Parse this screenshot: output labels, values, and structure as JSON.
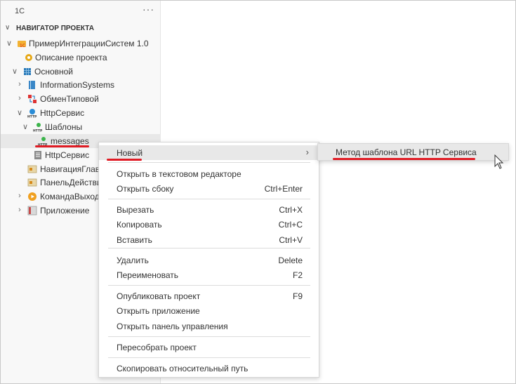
{
  "sidebar": {
    "title": "1С",
    "more_label": "···",
    "section": {
      "chevron": "∨",
      "label": "НАВИГАТОР ПРОЕКТА"
    },
    "tree": [
      {
        "name": "tree-item-project",
        "twisty": "∨",
        "icon": "project-1c-icon",
        "label": "ПримерИнтеграцииСистем 1.0"
      },
      {
        "name": "tree-item-project-description",
        "twisty": "",
        "icon": "gear-icon",
        "label": "Описание проекта"
      },
      {
        "name": "tree-item-main",
        "twisty": "∨",
        "icon": "grid-icon",
        "label": "Основной"
      },
      {
        "name": "tree-item-information-systems",
        "twisty": "›",
        "icon": "book-icon",
        "label": "InformationSystems"
      },
      {
        "name": "tree-item-exchange",
        "twisty": "›",
        "icon": "exchange-icon",
        "label": "ОбменТиповой"
      },
      {
        "name": "tree-item-http-service",
        "twisty": "∨",
        "icon": "http-globe-icon",
        "label": "HttpСервис"
      },
      {
        "name": "tree-item-templates",
        "twisty": "∨",
        "icon": "http-icon",
        "label": "Шаблоны"
      },
      {
        "name": "tree-item-messages",
        "twisty": "",
        "icon": "http-icon",
        "label": "messages"
      },
      {
        "name": "tree-item-http-service-module",
        "twisty": "",
        "icon": "module-icon",
        "label": "HttpСервис"
      },
      {
        "name": "tree-item-navigation",
        "twisty": "",
        "icon": "panel-icon",
        "label": "НавигацияГлав"
      },
      {
        "name": "tree-item-action-panel",
        "twisty": "",
        "icon": "panel-icon",
        "label": "ПанельДействи"
      },
      {
        "name": "tree-item-command",
        "twisty": "›",
        "icon": "play-icon",
        "label": "КомандаВыход"
      },
      {
        "name": "tree-item-application",
        "twisty": "›",
        "icon": "app-icon",
        "label": "Приложение"
      }
    ]
  },
  "context_menu": {
    "groups": [
      [
        {
          "label": "Новый",
          "shortcut": "",
          "submenu_arrow": "›"
        }
      ],
      [
        {
          "label": "Открыть в текстовом редакторе",
          "shortcut": ""
        },
        {
          "label": "Открыть сбоку",
          "shortcut": "Ctrl+Enter"
        }
      ],
      [
        {
          "label": "Вырезать",
          "shortcut": "Ctrl+X"
        },
        {
          "label": "Копировать",
          "shortcut": "Ctrl+C"
        },
        {
          "label": "Вставить",
          "shortcut": "Ctrl+V"
        }
      ],
      [
        {
          "label": "Удалить",
          "shortcut": "Delete"
        },
        {
          "label": "Переименовать",
          "shortcut": "F2"
        }
      ],
      [
        {
          "label": "Опубликовать проект",
          "shortcut": "F9"
        },
        {
          "label": "Открыть приложение",
          "shortcut": ""
        },
        {
          "label": "Открыть панель управления",
          "shortcut": ""
        }
      ],
      [
        {
          "label": "Пересобрать проект",
          "shortcut": ""
        }
      ],
      [
        {
          "label": "Скопировать относительный путь",
          "shortcut": ""
        }
      ]
    ]
  },
  "submenu": {
    "label": "Метод шаблона URL HTTP Сервиса"
  },
  "colors": {
    "annotation_red": "#e01b24",
    "selection": "#e8e8e8"
  }
}
